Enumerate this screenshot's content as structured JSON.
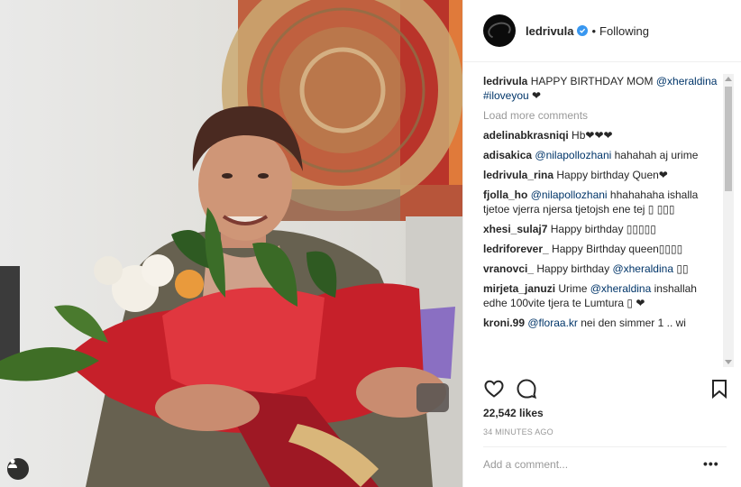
{
  "post": {
    "username": "ledrivula",
    "dot": "•",
    "follow_state": "Following",
    "caption_user": "ledrivula",
    "caption_text": "HAPPY BIRTHDAY MOM",
    "caption_mention": "@xheraldina",
    "caption_hashtag": "#iloveyou",
    "caption_heart": "❤",
    "load_more": "Load more comments"
  },
  "comments": [
    {
      "user": "adelinabkrasniqi",
      "parts": [
        {
          "t": "Hb❤❤❤",
          "m": false
        }
      ]
    },
    {
      "user": "adisakica",
      "parts": [
        {
          "t": "@nilapollozhani",
          "m": true
        },
        {
          "t": " hahahah aj urime",
          "m": false
        }
      ]
    },
    {
      "user": "ledrivula_rina",
      "parts": [
        {
          "t": "Happy birthday Quen❤",
          "m": false
        }
      ]
    },
    {
      "user": "fjolla_ho",
      "parts": [
        {
          "t": "@nilapollozhani",
          "m": true
        },
        {
          "t": " hhahahaha ishalla tjetoe vjerra njersa tjetojsh ene tej ▯ ▯▯▯",
          "m": false
        }
      ]
    },
    {
      "user": "xhesi_sulaj7",
      "parts": [
        {
          "t": "Happy birthday ▯▯▯▯▯",
          "m": false
        }
      ]
    },
    {
      "user": "ledriforever_",
      "parts": [
        {
          "t": "Happy Birthday queen▯▯▯▯",
          "m": false
        }
      ]
    },
    {
      "user": "vranovci_",
      "parts": [
        {
          "t": "Happy birthday ",
          "m": false
        },
        {
          "t": "@xheraldina",
          "m": true
        },
        {
          "t": " ▯▯",
          "m": false
        }
      ]
    },
    {
      "user": "mirjeta_januzi",
      "parts": [
        {
          "t": "Urime ",
          "m": false
        },
        {
          "t": "@xheraldina",
          "m": true
        },
        {
          "t": " inshallah edhe 100vite tjera te Lumtura ▯ ❤",
          "m": false
        }
      ]
    },
    {
      "user": "kroni.99",
      "parts": [
        {
          "t": "@floraa.kr",
          "m": true
        },
        {
          "t": " nei den simmer 1 .. wi",
          "m": false
        }
      ]
    }
  ],
  "likes": "22,542 likes",
  "time": "34 MINUTES AGO",
  "add_comment_placeholder": "Add a comment...",
  "more_label": "•••",
  "icons": {
    "like": "heart-icon",
    "comment": "comment-icon",
    "save": "bookmark-icon",
    "tag": "user-tag-icon",
    "verified": "verified-badge-icon"
  },
  "colors": {
    "link": "#003569",
    "verified": "#3897f0",
    "muted": "#999999"
  }
}
